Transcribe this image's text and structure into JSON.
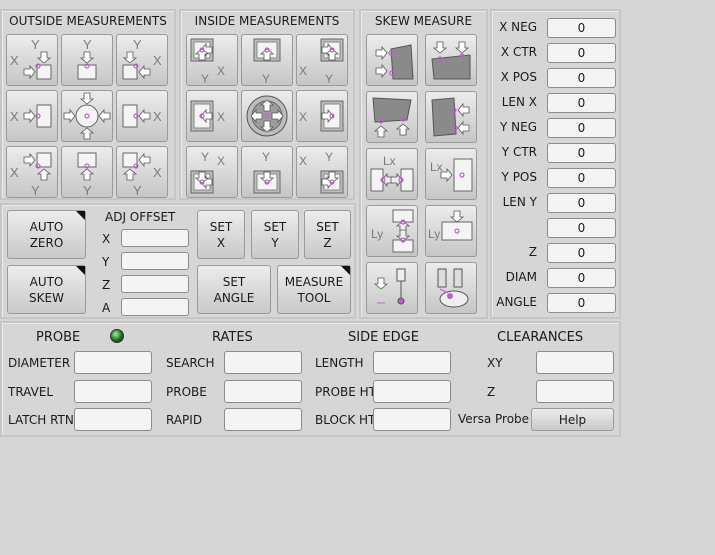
{
  "panels": {
    "outside": "OUTSIDE MEASUREMENTS",
    "inside": "INSIDE MEASUREMENTS",
    "skew": "SKEW MEASURE"
  },
  "outside_icons": [
    "outside-xminus-yplus-corner-icon",
    "outside-yplus-edge-icon",
    "outside-xplus-yplus-corner-icon",
    "outside-xminus-edge-icon",
    "outside-center-icon",
    "outside-xplus-edge-icon",
    "outside-xminus-yminus-corner-icon",
    "outside-yminus-edge-icon",
    "outside-xplus-yminus-corner-icon"
  ],
  "inside_icons": [
    "inside-xminus-yplus-corner-icon",
    "inside-yplus-edge-icon",
    "inside-xplus-yplus-corner-icon",
    "inside-xminus-edge-icon",
    "inside-hole-center-icon",
    "inside-xplus-edge-icon",
    "inside-xminus-yminus-corner-icon",
    "inside-yminus-edge-icon",
    "inside-xplus-yminus-corner-icon"
  ],
  "skew_icons": [
    "skew-x-left-icon",
    "skew-y-top-icon",
    "skew-x-bottom-icon",
    "skew-y-right-icon",
    "length-x-outside-icon",
    "length-x-inside-icon",
    "length-y-outside-icon",
    "length-y-inside-icon",
    "probe-down-icon",
    "tool-measure-icon"
  ],
  "icon_letters": {
    "x": "X",
    "y": "Y",
    "lx": "Lx",
    "ly": "Ly"
  },
  "buttons": {
    "auto_zero": "AUTO\nZERO",
    "auto_skew": "AUTO\nSKEW",
    "set_x": "SET\nX",
    "set_y": "SET\nY",
    "set_z": "SET\nZ",
    "set_angle": "SET\nANGLE",
    "measure_tool": "MEASURE\nTOOL",
    "help": "Help"
  },
  "adj_offset": {
    "title": "ADJ OFFSET",
    "rows": [
      {
        "label": "X",
        "value": ""
      },
      {
        "label": "Y",
        "value": ""
      },
      {
        "label": "Z",
        "value": ""
      },
      {
        "label": "A",
        "value": ""
      }
    ]
  },
  "results": [
    {
      "label": "X NEG",
      "value": "0"
    },
    {
      "label": "X CTR",
      "value": "0"
    },
    {
      "label": "X POS",
      "value": "0"
    },
    {
      "label": "LEN X",
      "value": "0"
    },
    {
      "label": "Y NEG",
      "value": "0"
    },
    {
      "label": "Y CTR",
      "value": "0"
    },
    {
      "label": "Y POS",
      "value": "0"
    },
    {
      "label": "LEN Y",
      "value": "0"
    },
    {
      "label": "",
      "value": "0"
    },
    {
      "label": "Z",
      "value": "0"
    },
    {
      "label": "DIAM",
      "value": "0"
    },
    {
      "label": "ANGLE",
      "value": "0"
    }
  ],
  "settings": {
    "headers": {
      "probe": "PROBE",
      "rates": "RATES",
      "side_edge": "SIDE EDGE",
      "clearances": "CLEARANCES"
    },
    "probe": [
      {
        "label": "DIAMETER",
        "value": ""
      },
      {
        "label": "TRAVEL",
        "value": ""
      },
      {
        "label": "LATCH RTN",
        "value": ""
      }
    ],
    "rates": [
      {
        "label": "SEARCH",
        "value": ""
      },
      {
        "label": "PROBE",
        "value": ""
      },
      {
        "label": "RAPID",
        "value": ""
      }
    ],
    "side_edge": [
      {
        "label": "LENGTH",
        "value": ""
      },
      {
        "label": "PROBE HT",
        "value": ""
      },
      {
        "label": "BLOCK HT",
        "value": ""
      }
    ],
    "clearances": [
      {
        "label": "XY",
        "value": ""
      },
      {
        "label": "Z",
        "value": ""
      }
    ],
    "versa_label": "Versa Probe"
  },
  "colors": {
    "accent": "#c060d0",
    "led": "#2a9a2a"
  }
}
